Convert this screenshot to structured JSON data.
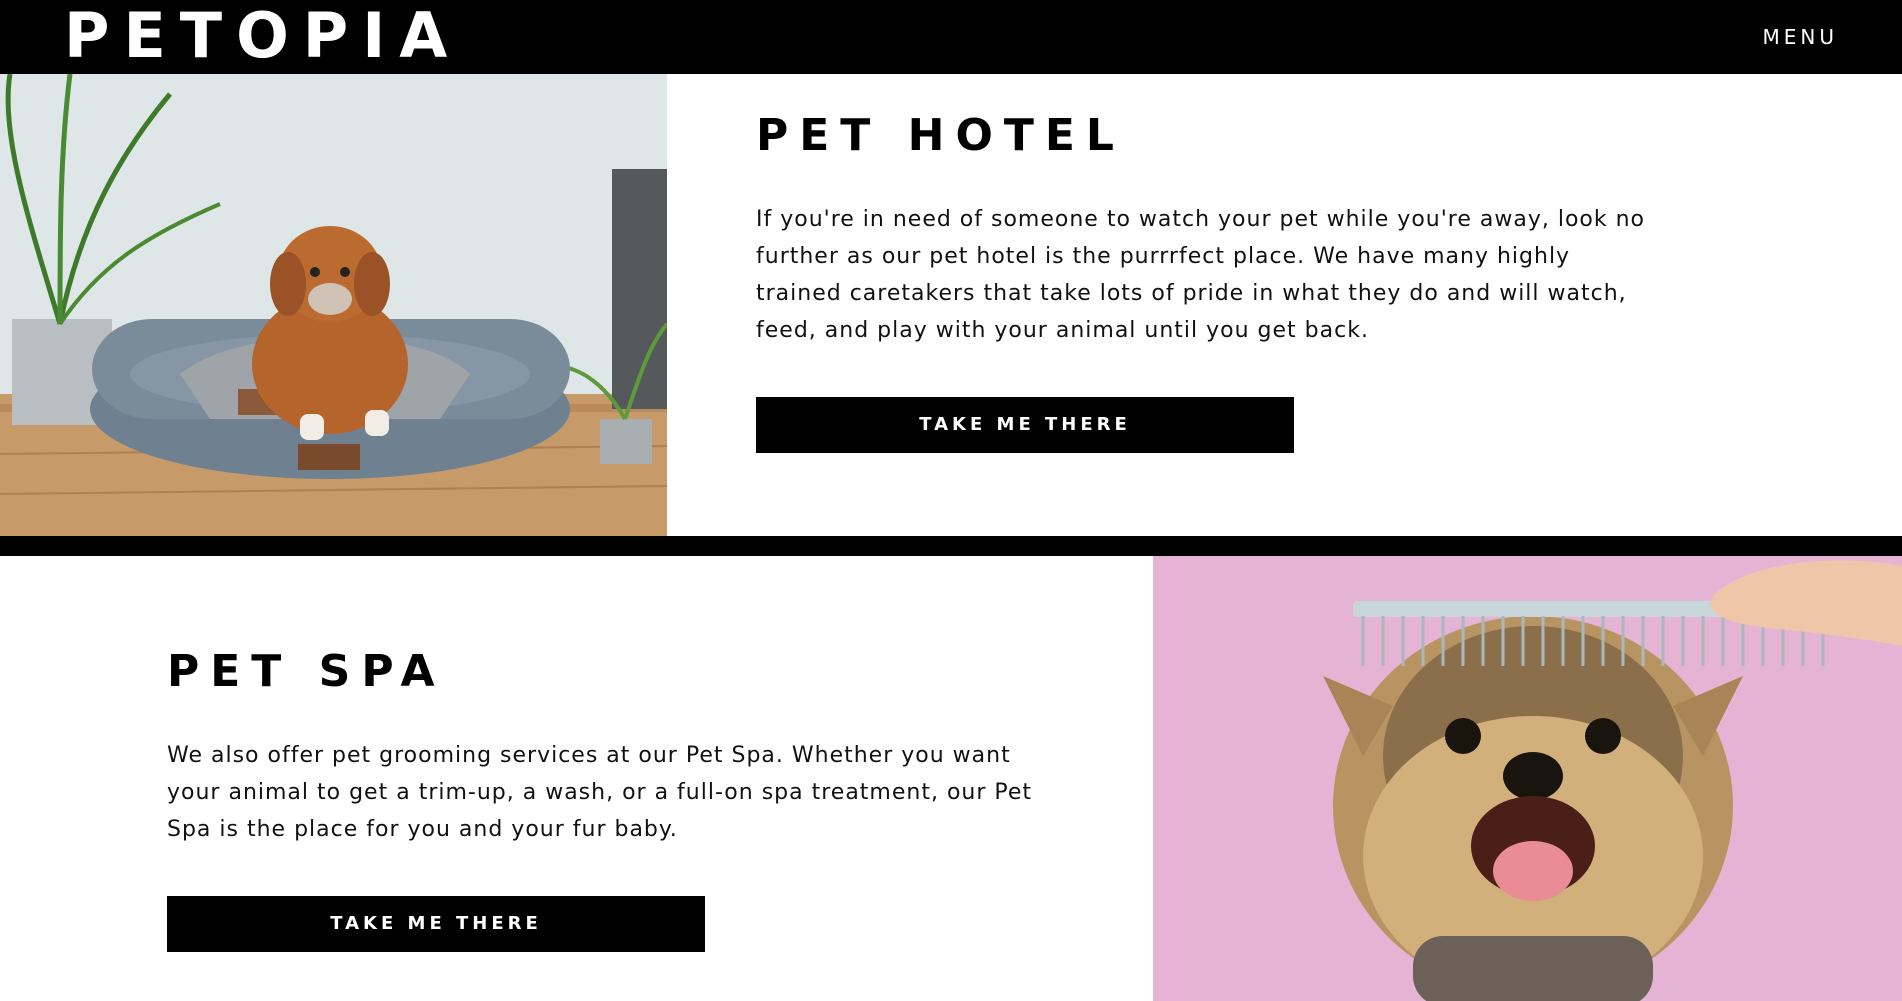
{
  "header": {
    "brand": "PETOPIA",
    "menu_label": "MENU"
  },
  "hotel": {
    "title": "PET HOTEL",
    "body": "If you're in need of someone to watch your pet while you're away, look no further as our pet hotel is the purrrfect place. We have many highly trained caretakers that take lots of pride in what they do and will watch, feed, and play with your animal until you get back.",
    "button_label": "TAKE ME THERE"
  },
  "spa": {
    "title": "PET SPA",
    "body": "We also offer pet grooming services at our Pet Spa. Whether you want your animal to get a trim-up, a wash, or a full-on spa treatment, our Pet Spa is the place for you and your fur baby.",
    "button_label": "TAKE ME THERE"
  },
  "colors": {
    "header_bg": "#000000",
    "button_bg": "#000000",
    "spa_photo_bg": "#e5b4d4"
  }
}
